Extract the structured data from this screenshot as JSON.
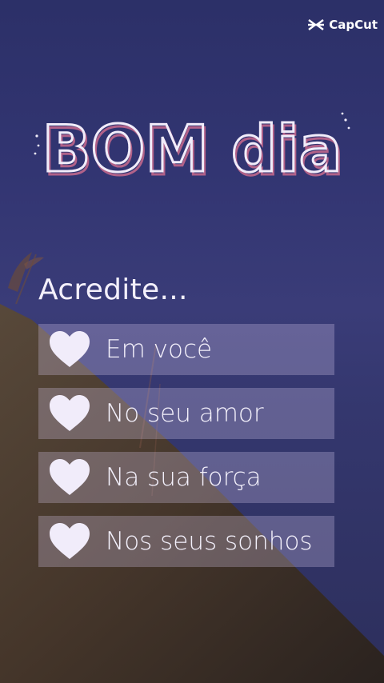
{
  "watermark": {
    "text": "CapCut",
    "icon": "capcut-logo-icon"
  },
  "title": "BOM dia",
  "subtitle": "Acredite...",
  "items": [
    {
      "label": "Em você",
      "icon": "heart-icon"
    },
    {
      "label": "No seu amor",
      "icon": "heart-icon"
    },
    {
      "label": "Na sua força",
      "icon": "heart-icon"
    },
    {
      "label": "Nos seus sonhos",
      "icon": "heart-icon"
    }
  ],
  "colors": {
    "sky": "#323572",
    "hill": "#4a3a2a",
    "text": "#f3f0fb",
    "heart": "#f1ecfa",
    "title_outline": "#c86a8e",
    "panel": "#dccdf0"
  }
}
